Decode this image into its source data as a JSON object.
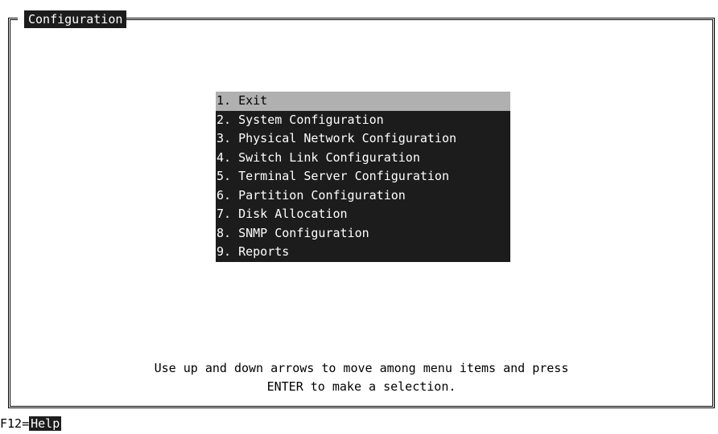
{
  "window": {
    "title": "Configuration"
  },
  "menu": {
    "items": [
      {
        "label": "1. Exit",
        "selected": true
      },
      {
        "label": "2. System Configuration",
        "selected": false
      },
      {
        "label": "3. Physical Network Configuration",
        "selected": false
      },
      {
        "label": "4. Switch Link Configuration",
        "selected": false
      },
      {
        "label": "5. Terminal Server Configuration",
        "selected": false
      },
      {
        "label": "6. Partition Configuration",
        "selected": false
      },
      {
        "label": "7. Disk Allocation",
        "selected": false
      },
      {
        "label": "8. SNMP Configuration",
        "selected": false
      },
      {
        "label": "9. Reports",
        "selected": false
      }
    ]
  },
  "instructions": {
    "line1": "Use up and down arrows to move among menu items and press",
    "line2": "ENTER to make a selection."
  },
  "function_keys": {
    "key": "F12=",
    "action": "Help"
  },
  "colors": {
    "menu_background": "#1c1c1c",
    "selected_background": "#b0b0b0",
    "text_on_dark": "#ffffff",
    "page_background": "#ffffff"
  }
}
